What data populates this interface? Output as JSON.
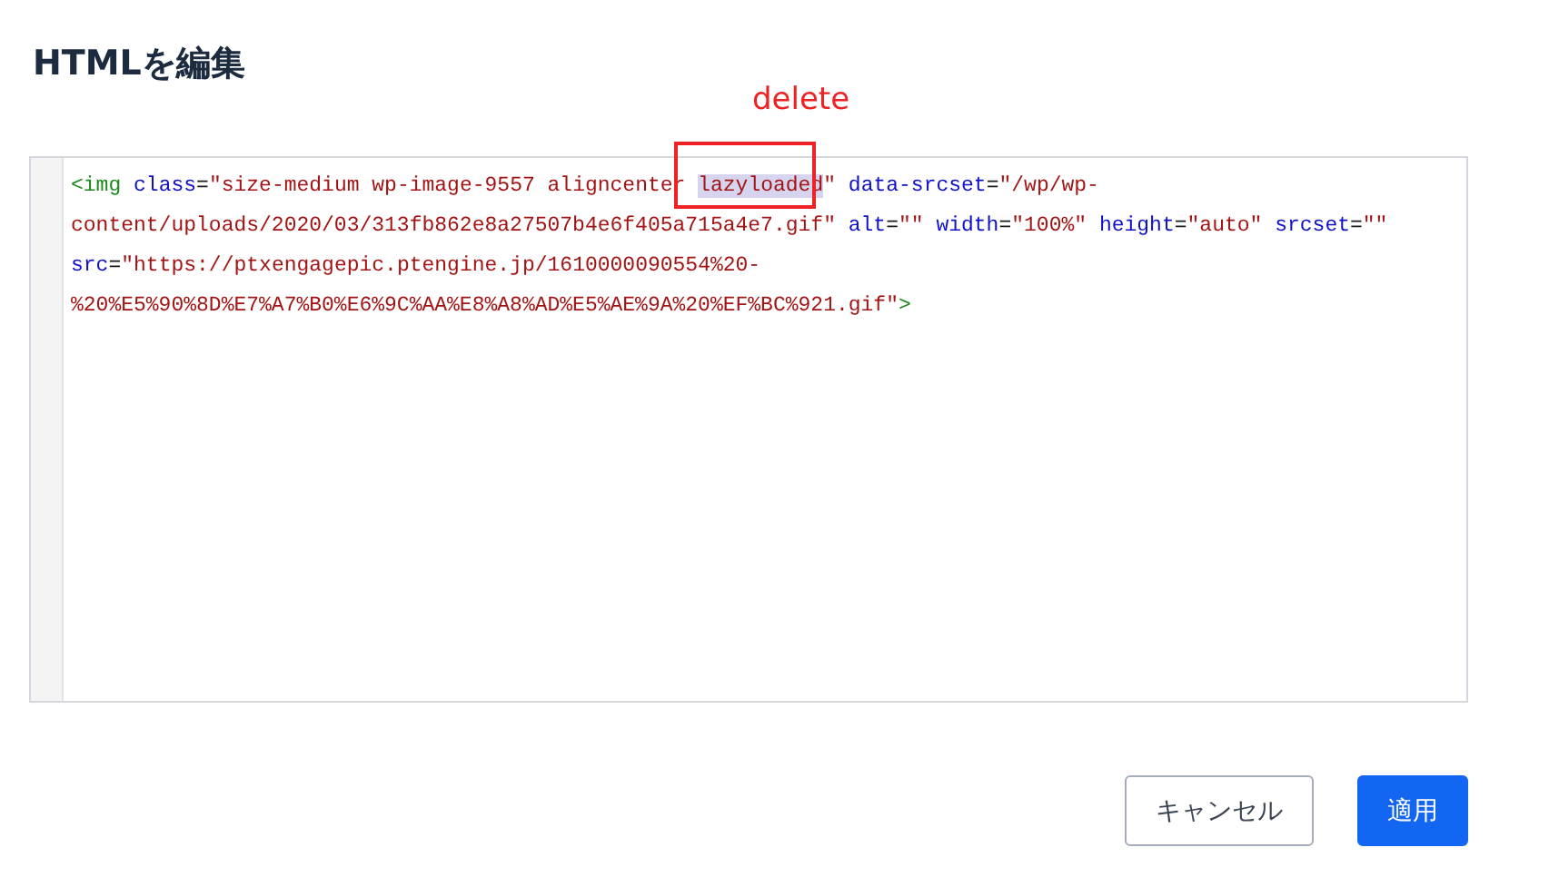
{
  "dialog": {
    "title": "HTMLを編集"
  },
  "editor": {
    "lines": [
      [
        {
          "kind": "tag",
          "text": "<img"
        },
        {
          "kind": "attr",
          "text": " class"
        },
        {
          "kind": "punct",
          "text": "="
        },
        {
          "kind": "value",
          "text": "\"size-medium wp-image-9557 aligncenter "
        },
        {
          "kind": "value",
          "text": "lazyloaded",
          "selected": true
        },
        {
          "kind": "value",
          "text": "\""
        },
        {
          "kind": "attr",
          "text": " data-srcset"
        },
        {
          "kind": "punct",
          "text": "="
        },
        {
          "kind": "value",
          "text": "\"/wp/wp-"
        }
      ],
      [
        {
          "kind": "value",
          "text": "content/uploads/2020/03/313fb862e8a27507b4e6f405a715a4e7.gif\""
        },
        {
          "kind": "attr",
          "text": " alt"
        },
        {
          "kind": "punct",
          "text": "="
        },
        {
          "kind": "value",
          "text": "\"\""
        },
        {
          "kind": "attr",
          "text": " width"
        },
        {
          "kind": "punct",
          "text": "="
        },
        {
          "kind": "value",
          "text": "\"100%\""
        },
        {
          "kind": "attr",
          "text": " height"
        },
        {
          "kind": "punct",
          "text": "="
        },
        {
          "kind": "value",
          "text": "\"auto\""
        },
        {
          "kind": "attr",
          "text": " srcset"
        },
        {
          "kind": "punct",
          "text": "="
        },
        {
          "kind": "value",
          "text": "\"\""
        }
      ],
      [
        {
          "kind": "attr",
          "text": "src"
        },
        {
          "kind": "punct",
          "text": "="
        },
        {
          "kind": "value",
          "text": "\"https://ptxengagepic.ptengine.jp/1610000090554%20-"
        }
      ],
      [
        {
          "kind": "value",
          "text": "%20%E5%90%8D%E7%A7%B0%E6%9C%AA%E8%A8%AD%E5%AE%9A%20%EF%BC%921.gif\""
        },
        {
          "kind": "tag",
          "text": ">"
        }
      ]
    ]
  },
  "annotation": {
    "label": "delete"
  },
  "buttons": [
    {
      "kind": "secondary",
      "label": "キャンセル"
    },
    {
      "kind": "primary",
      "label": "適用"
    }
  ]
}
